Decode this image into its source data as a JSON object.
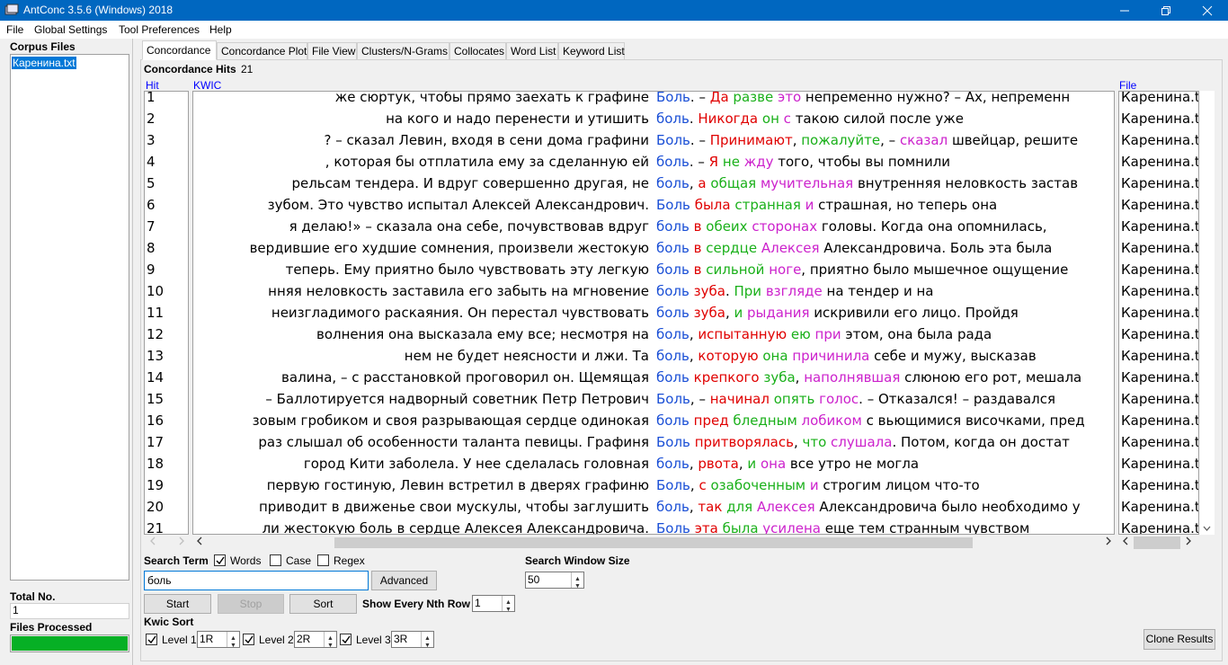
{
  "window": {
    "title": "AntConc 3.5.6 (Windows) 2018"
  },
  "menu": [
    "File",
    "Global Settings",
    "Tool Preferences",
    "Help"
  ],
  "left_panel": {
    "corpus_files_label": "Corpus Files",
    "files": [
      "Каренина.txt"
    ],
    "total_label": "Total No.",
    "total_value": "1",
    "processed_label": "Files Processed",
    "progress": 1.0
  },
  "tabs": [
    "Concordance",
    "Concordance Plot",
    "File View",
    "Clusters/N-Grams",
    "Collocates",
    "Word List",
    "Keyword List"
  ],
  "concordance": {
    "hits_label": "Concordance Hits",
    "hits_count": "21",
    "col_hit": "Hit",
    "col_kwic": "KWIC",
    "col_file": "File",
    "rows": [
      {
        "n": "1",
        "left": "же сюртук, чтобы прямо заехать к графине",
        "kw": "Боль",
        "right": [
          [
            ". – ",
            "k"
          ],
          [
            "Да",
            "r"
          ],
          [
            " ",
            "k"
          ],
          [
            "разве",
            "g"
          ],
          [
            " ",
            "k"
          ],
          [
            "это",
            "m"
          ],
          [
            " непременно нужно? – Ах, непременн",
            "k"
          ]
        ],
        "file": "Каренина.txt"
      },
      {
        "n": "2",
        "left": "на кого и надо перенести и утишить",
        "kw": "боль",
        "right": [
          [
            ". ",
            "k"
          ],
          [
            "Никогда",
            "r"
          ],
          [
            " ",
            "k"
          ],
          [
            "он",
            "g"
          ],
          [
            " ",
            "k"
          ],
          [
            "с",
            "m"
          ],
          [
            " такою силой после уже",
            "k"
          ]
        ],
        "file": "Каренина.txt"
      },
      {
        "n": "3",
        "left": "? – сказал Левин, входя в сени дома графини",
        "kw": "Боль",
        "right": [
          [
            ". – ",
            "k"
          ],
          [
            "Принимают",
            "r"
          ],
          [
            ", ",
            "k"
          ],
          [
            "пожалуйте",
            "g"
          ],
          [
            ", – ",
            "k"
          ],
          [
            "сказал",
            "m"
          ],
          [
            " швейцар, решите",
            "k"
          ]
        ],
        "file": "Каренина.txt"
      },
      {
        "n": "4",
        "left": ", которая бы отплатила ему за сделанную ей",
        "kw": "боль",
        "right": [
          [
            ". – ",
            "k"
          ],
          [
            "Я",
            "r"
          ],
          [
            " ",
            "k"
          ],
          [
            "не",
            "g"
          ],
          [
            " ",
            "k"
          ],
          [
            "жду",
            "m"
          ],
          [
            " того, чтобы вы помнили",
            "k"
          ]
        ],
        "file": "Каренина.txt"
      },
      {
        "n": "5",
        "left": "рельсам тендера. И вдруг совершенно другая, не",
        "kw": "боль",
        "right": [
          [
            ", ",
            "k"
          ],
          [
            "а",
            "r"
          ],
          [
            " ",
            "k"
          ],
          [
            "общая",
            "g"
          ],
          [
            " ",
            "k"
          ],
          [
            "мучительная",
            "m"
          ],
          [
            " внутренняя неловкость застав",
            "k"
          ]
        ],
        "file": "Каренина.txt"
      },
      {
        "n": "6",
        "left": "зубом. Это чувство испытал Алексей Александрович.",
        "kw": "Боль",
        "right": [
          [
            " ",
            "k"
          ],
          [
            "была",
            "r"
          ],
          [
            " ",
            "k"
          ],
          [
            "странная",
            "g"
          ],
          [
            " ",
            "k"
          ],
          [
            "и",
            "m"
          ],
          [
            " страшная, но теперь она",
            "k"
          ]
        ],
        "file": "Каренина.txt"
      },
      {
        "n": "7",
        "left": "я делаю!» – сказала она себе, почувствовав вдруг",
        "kw": "боль",
        "right": [
          [
            " ",
            "k"
          ],
          [
            "в",
            "r"
          ],
          [
            " ",
            "k"
          ],
          [
            "обеих",
            "g"
          ],
          [
            " ",
            "k"
          ],
          [
            "сторонах",
            "m"
          ],
          [
            " головы. Когда она опомнилась,",
            "k"
          ]
        ],
        "file": "Каренина.txt"
      },
      {
        "n": "8",
        "left": "вердившие его худшие сомнения, произвели жестокую",
        "kw": "боль",
        "right": [
          [
            " ",
            "k"
          ],
          [
            "в",
            "r"
          ],
          [
            " ",
            "k"
          ],
          [
            "сердце",
            "g"
          ],
          [
            " ",
            "k"
          ],
          [
            "Алексея",
            "m"
          ],
          [
            " Александровича. Боль эта была",
            "k"
          ]
        ],
        "file": "Каренина.txt"
      },
      {
        "n": "9",
        "left": "теперь. Ему приятно было чувствовать эту легкую",
        "kw": "боль",
        "right": [
          [
            " ",
            "k"
          ],
          [
            "в",
            "r"
          ],
          [
            " ",
            "k"
          ],
          [
            "сильной",
            "g"
          ],
          [
            " ",
            "k"
          ],
          [
            "ноге",
            "m"
          ],
          [
            ", приятно было мышечное ощущение",
            "k"
          ]
        ],
        "file": "Каренина.txt"
      },
      {
        "n": "10",
        "left": "нняя неловкость заставила его забыть на мгновение",
        "kw": "боль",
        "right": [
          [
            " ",
            "k"
          ],
          [
            "зуба",
            "r"
          ],
          [
            ". ",
            "k"
          ],
          [
            "При",
            "g"
          ],
          [
            " ",
            "k"
          ],
          [
            "взгляде",
            "m"
          ],
          [
            " на тендер и на",
            "k"
          ]
        ],
        "file": "Каренина.txt"
      },
      {
        "n": "11",
        "left": "неизгладимого раскаяния. Он перестал чувствовать",
        "kw": "боль",
        "right": [
          [
            " ",
            "k"
          ],
          [
            "зуба",
            "r"
          ],
          [
            ", ",
            "k"
          ],
          [
            "и",
            "g"
          ],
          [
            " ",
            "k"
          ],
          [
            "рыдания",
            "m"
          ],
          [
            " искривили его лицо. Пройдя",
            "k"
          ]
        ],
        "file": "Каренина.txt"
      },
      {
        "n": "12",
        "left": "волнения она высказала ему все; несмотря на",
        "kw": "боль",
        "right": [
          [
            ", ",
            "k"
          ],
          [
            "испытанную",
            "r"
          ],
          [
            " ",
            "k"
          ],
          [
            "ею",
            "g"
          ],
          [
            " ",
            "k"
          ],
          [
            "при",
            "m"
          ],
          [
            " этом, она была рада",
            "k"
          ]
        ],
        "file": "Каренина.txt"
      },
      {
        "n": "13",
        "left": "нем не будет неясности и лжи. Та",
        "kw": "боль",
        "right": [
          [
            ", ",
            "k"
          ],
          [
            "которую",
            "r"
          ],
          [
            " ",
            "k"
          ],
          [
            "она",
            "g"
          ],
          [
            " ",
            "k"
          ],
          [
            "причинила",
            "m"
          ],
          [
            " себе и мужу, высказав",
            "k"
          ]
        ],
        "file": "Каренина.txt"
      },
      {
        "n": "14",
        "left": "валина, – с расстановкой проговорил он.   Щемящая",
        "kw": "боль",
        "right": [
          [
            " ",
            "k"
          ],
          [
            "крепкого",
            "r"
          ],
          [
            " ",
            "k"
          ],
          [
            "зуба",
            "g"
          ],
          [
            ", ",
            "k"
          ],
          [
            "наполнявшая",
            "m"
          ],
          [
            " слюною его рот, мешала",
            "k"
          ]
        ],
        "file": "Каренина.txt"
      },
      {
        "n": "15",
        "left": "– Баллотируется надворный советник Петр Петрович",
        "kw": "Боль",
        "right": [
          [
            ", – ",
            "k"
          ],
          [
            "начинал",
            "r"
          ],
          [
            " ",
            "k"
          ],
          [
            "опять",
            "g"
          ],
          [
            " ",
            "k"
          ],
          [
            "голос",
            "m"
          ],
          [
            ". – Отказался! – раздавался",
            "k"
          ]
        ],
        "file": "Каренина.txt"
      },
      {
        "n": "16",
        "left": "зовым гробиком и своя разрывающая сердце одинокая",
        "kw": "боль",
        "right": [
          [
            " ",
            "k"
          ],
          [
            "пред",
            "r"
          ],
          [
            " ",
            "k"
          ],
          [
            "бледным",
            "g"
          ],
          [
            " ",
            "k"
          ],
          [
            "лобиком",
            "m"
          ],
          [
            " с вьющимися височками, пред",
            "k"
          ]
        ],
        "file": "Каренина.txt"
      },
      {
        "n": "17",
        "left": "раз слышал об особенности таланта певицы. Графиня",
        "kw": "Боль",
        "right": [
          [
            " ",
            "k"
          ],
          [
            "притворялась",
            "r"
          ],
          [
            ", ",
            "k"
          ],
          [
            "что",
            "g"
          ],
          [
            " ",
            "k"
          ],
          [
            "слушала",
            "m"
          ],
          [
            ". Потом, когда он достат",
            "k"
          ]
        ],
        "file": "Каренина.txt"
      },
      {
        "n": "18",
        "left": "город Кити заболела. У нее сделалась головная",
        "kw": "боль",
        "right": [
          [
            ", ",
            "k"
          ],
          [
            "рвота",
            "r"
          ],
          [
            ", ",
            "k"
          ],
          [
            "и",
            "g"
          ],
          [
            " ",
            "k"
          ],
          [
            "она",
            "m"
          ],
          [
            " все утро не могла",
            "k"
          ]
        ],
        "file": "Каренина.txt"
      },
      {
        "n": "19",
        "left": "первую гостиную, Левин встретил в дверях графиню",
        "kw": "Боль",
        "right": [
          [
            ", ",
            "k"
          ],
          [
            "с",
            "r"
          ],
          [
            " ",
            "k"
          ],
          [
            "озабоченным",
            "g"
          ],
          [
            " ",
            "k"
          ],
          [
            "и",
            "m"
          ],
          [
            " строгим лицом что-то",
            "k"
          ]
        ],
        "file": "Каренина.txt"
      },
      {
        "n": "20",
        "left": "приводит в движенье свои мускулы, чтобы заглушить",
        "kw": "боль",
        "right": [
          [
            ", ",
            "k"
          ],
          [
            "так",
            "r"
          ],
          [
            " ",
            "k"
          ],
          [
            "для",
            "g"
          ],
          [
            " ",
            "k"
          ],
          [
            "Алексея",
            "m"
          ],
          [
            " Александровича было необходимо у",
            "k"
          ]
        ],
        "file": "Каренина.txt"
      },
      {
        "n": "21",
        "left": "ли жестокую боль в сердце Алексея Александровича.",
        "kw": "Боль",
        "right": [
          [
            " ",
            "k"
          ],
          [
            "эта",
            "r"
          ],
          [
            " ",
            "k"
          ],
          [
            "была",
            "g"
          ],
          [
            " ",
            "k"
          ],
          [
            "усилена",
            "m"
          ],
          [
            " еще тем странным чувством",
            "k"
          ]
        ],
        "file": "Каренина.txt"
      }
    ]
  },
  "search": {
    "term_label": "Search Term",
    "words_label": "Words",
    "words_checked": true,
    "case_label": "Case",
    "case_checked": false,
    "regex_label": "Regex",
    "regex_checked": false,
    "term_value": "боль",
    "advanced_label": "Advanced",
    "window_size_label": "Search Window Size",
    "window_size_value": "50",
    "start_label": "Start",
    "stop_label": "Stop",
    "sort_label": "Sort",
    "nth_row_label": "Show Every Nth Row",
    "nth_row_value": "1"
  },
  "kwic_sort": {
    "label": "Kwic Sort",
    "levels": [
      {
        "label": "Level 1",
        "value": "1R",
        "checked": true
      },
      {
        "label": "Level 2",
        "value": "2R",
        "checked": true
      },
      {
        "label": "Level 3",
        "value": "3R",
        "checked": true
      }
    ]
  },
  "clone_label": "Clone Results",
  "colors": {
    "keyword": "#1a4fd6",
    "sort_level_1": "#e00000",
    "sort_level_2": "#1ab01a",
    "sort_level_3": "#cc22cc",
    "progress": "#06b025",
    "titlebar": "#0067c0"
  }
}
